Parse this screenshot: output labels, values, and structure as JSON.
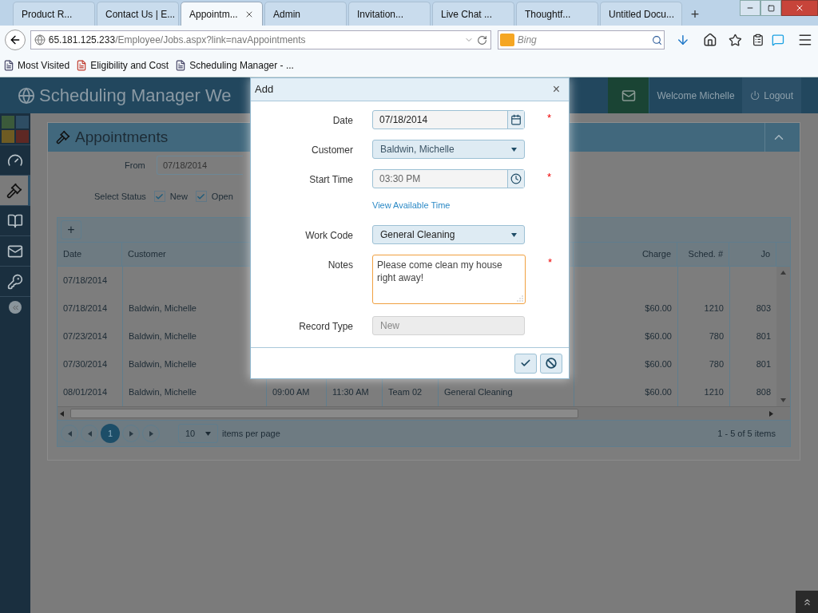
{
  "browser": {
    "tabs": [
      {
        "label": "Product R...",
        "selected": false
      },
      {
        "label": "Contact Us | E...",
        "selected": false
      },
      {
        "label": "Appointm...",
        "selected": true
      },
      {
        "label": "Admin",
        "selected": false
      },
      {
        "label": "Invitation...",
        "selected": false
      },
      {
        "label": "Live Chat ...",
        "selected": false
      },
      {
        "label": "Thoughtf...",
        "selected": false
      },
      {
        "label": "Untitled Docu...",
        "selected": false
      }
    ],
    "new_tab": "+",
    "address": {
      "host": "65.181.125.233",
      "path": "/Employee/Jobs.aspx?link=navAppointments"
    },
    "search": {
      "placeholder": "Bing"
    },
    "bookmarks": [
      "Most Visited",
      "Eligibility and Cost",
      "Scheduling Manager - ..."
    ]
  },
  "app": {
    "title": "Scheduling Manager We",
    "welcome": "Welcome Michelle",
    "logout": "Logout"
  },
  "sidebar": {
    "items": [
      {
        "kind": "tiles",
        "selected": false
      },
      {
        "kind": "gauge",
        "selected": false
      },
      {
        "kind": "gavel",
        "selected": true
      },
      {
        "kind": "book",
        "selected": false
      },
      {
        "kind": "mail",
        "selected": false
      },
      {
        "kind": "key",
        "selected": false
      },
      {
        "kind": "collapse",
        "selected": false
      }
    ]
  },
  "panel": {
    "title": "Appointments",
    "from_label": "From",
    "from_value": "07/18/2014",
    "status_label": "Select Status",
    "statuses": [
      {
        "label": "New",
        "checked": true
      },
      {
        "label": "Open",
        "checked": true
      }
    ]
  },
  "table": {
    "add": "+",
    "columns": [
      "Date",
      "Customer",
      "Charge",
      "Sched. #",
      "Jo"
    ],
    "rows": [
      {
        "date": "07/18/2014"
      },
      {
        "date": "07/18/2014",
        "customer": "Baldwin, Michelle",
        "charge": "$60.00",
        "sched": "1210",
        "job": "803"
      },
      {
        "date": "07/23/2014",
        "customer": "Baldwin, Michelle",
        "charge": "$60.00",
        "sched": "780",
        "job": "801"
      },
      {
        "date": "07/30/2014",
        "customer": "Baldwin, Michelle",
        "charge": "$60.00",
        "sched": "780",
        "job": "801"
      },
      {
        "date": "08/01/2014",
        "customer": "Baldwin, Michelle",
        "column_3": "09:00 AM",
        "column_4": "11:30 AM",
        "column_5": "Team 02",
        "column_6": "General Cleaning",
        "charge": "$60.00",
        "sched": "1210",
        "job": "808"
      }
    ],
    "pager": {
      "pages": [
        {
          "label": "1",
          "selected": true
        }
      ],
      "page_size": "10",
      "page_size_label": "items per page",
      "summary": "1 - 5 of 5 items"
    }
  },
  "dialog": {
    "title": "Add",
    "close": "×",
    "fields": [
      {
        "label": "Date",
        "kind": "date",
        "value": "07/18/2014",
        "required_mark": "*"
      },
      {
        "label": "Customer",
        "kind": "select",
        "value": "Baldwin, Michelle"
      },
      {
        "label": "Start Time",
        "kind": "time",
        "value": "03:30 PM",
        "required_mark": "*"
      },
      {
        "kind": "link",
        "value": "View Available Time"
      },
      {
        "label": "Work Code",
        "kind": "select",
        "value": "General Cleaning"
      },
      {
        "label": "Notes",
        "kind": "textarea",
        "value": "Please come clean my house right away!",
        "required_mark": "*"
      },
      {
        "label": "Record Type",
        "kind": "readonly",
        "value": "New"
      }
    ]
  }
}
